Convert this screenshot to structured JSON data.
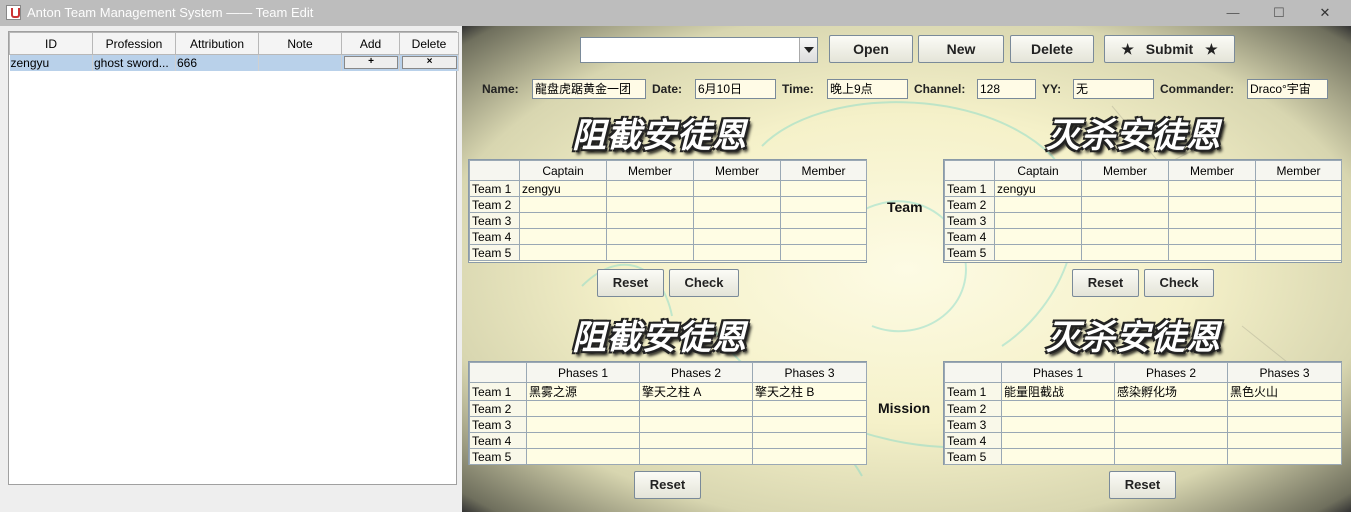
{
  "window": {
    "title": "Anton Team Management System —— Team Edit"
  },
  "roster": {
    "columns": [
      "ID",
      "Profession",
      "Attribution",
      "Note",
      "Add",
      "Delete"
    ],
    "rows": [
      {
        "id": "zengyu",
        "profession": "ghost sword...",
        "attribution": "666",
        "note": "",
        "add": "+",
        "delete": "×"
      }
    ]
  },
  "toolbar": {
    "combo_value": "",
    "open": "Open",
    "new": "New",
    "delete": "Delete",
    "submit": "Submit"
  },
  "info": {
    "name_label": "Name:",
    "name_value": "龍盘虎踞黄金一团",
    "date_label": "Date:",
    "date_value": "6月10日",
    "time_label": "Time:",
    "time_value": "晚上9点",
    "channel_label": "Channel:",
    "channel_value": "128",
    "yy_label": "YY:",
    "yy_value": "无",
    "commander_label": "Commander:",
    "commander_value": "Draco°宇宙"
  },
  "headings": {
    "left": "阻截安徒恩",
    "right": "灭杀安徒恩"
  },
  "labels": {
    "team": "Team",
    "mission": "Mission",
    "reset": "Reset",
    "check": "Check"
  },
  "team_tables": {
    "columns": [
      "",
      "Captain",
      "Member",
      "Member",
      "Member"
    ],
    "left": [
      [
        "Team 1",
        "zengyu",
        "",
        "",
        ""
      ],
      [
        "Team 2",
        "",
        "",
        "",
        ""
      ],
      [
        "Team 3",
        "",
        "",
        "",
        ""
      ],
      [
        "Team 4",
        "",
        "",
        "",
        ""
      ],
      [
        "Team 5",
        "",
        "",
        "",
        ""
      ]
    ],
    "right": [
      [
        "Team 1",
        "zengyu",
        "",
        "",
        ""
      ],
      [
        "Team 2",
        "",
        "",
        "",
        ""
      ],
      [
        "Team 3",
        "",
        "",
        "",
        ""
      ],
      [
        "Team 4",
        "",
        "",
        "",
        ""
      ],
      [
        "Team 5",
        "",
        "",
        "",
        ""
      ]
    ]
  },
  "mission_tables": {
    "columns": [
      "",
      "Phases 1",
      "Phases 2",
      "Phases 3"
    ],
    "left": [
      [
        "Team 1",
        "黑雾之源",
        "擎天之柱 A",
        "擎天之柱 B"
      ],
      [
        "Team 2",
        "",
        "",
        ""
      ],
      [
        "Team 3",
        "",
        "",
        ""
      ],
      [
        "Team 4",
        "",
        "",
        ""
      ],
      [
        "Team 5",
        "",
        "",
        ""
      ]
    ],
    "right": [
      [
        "Team 1",
        "能量阻截战",
        "感染孵化场",
        "黑色火山"
      ],
      [
        "Team 2",
        "",
        "",
        ""
      ],
      [
        "Team 3",
        "",
        "",
        ""
      ],
      [
        "Team 4",
        "",
        "",
        ""
      ],
      [
        "Team 5",
        "",
        "",
        ""
      ]
    ]
  }
}
